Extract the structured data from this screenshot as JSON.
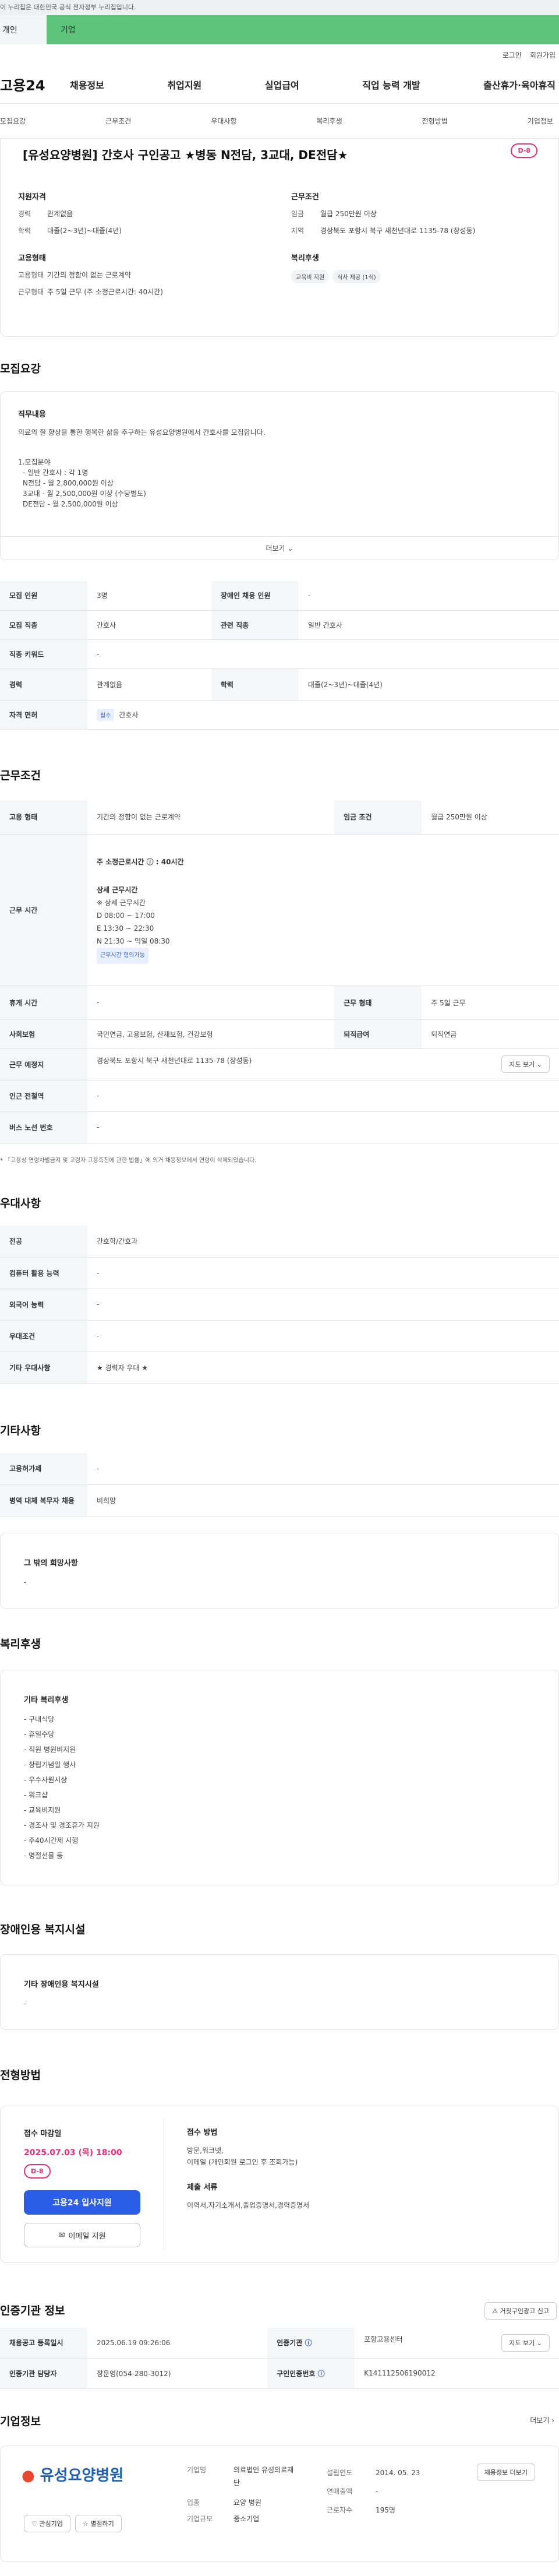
{
  "gov_strip": "이 누리집은 대한민국 공식 전자정부 누리집입니다.",
  "tabs": [
    {
      "label": "개인"
    },
    {
      "label": "기업"
    }
  ],
  "util": {
    "login": "로그인",
    "join": "회원가입"
  },
  "logo": "고용24",
  "gnb": [
    "채용정보",
    "취업지원",
    "실업급여",
    "직업 능력 개발",
    "출산휴가·육아휴직"
  ],
  "subnav": [
    "모집요강",
    "근무조건",
    "우대사항",
    "복리후생",
    "전형방법",
    "기업정보"
  ],
  "summary": {
    "title": "[유성요양병원] 간호사 구인공고 ★병동 N전담, 3교대, DE전담★",
    "dday": "D-8",
    "qual_head": "지원자격",
    "qual": [
      {
        "k": "경력",
        "v": "관계없음"
      },
      {
        "k": "학력",
        "v": "대졸(2~3년)~대졸(4년)"
      }
    ],
    "emp_head": "고용형태",
    "emp": [
      {
        "k": "고용형태",
        "v": "기간의 정함이 없는 근로계약"
      },
      {
        "k": "근무형태",
        "v": "주 5일 근무 (주 소정근로시간: 40시간)"
      }
    ],
    "cond_head": "근무조건",
    "cond": [
      {
        "k": "임금",
        "v": "월급 250만원 이상"
      },
      {
        "k": "지역",
        "v": "경상북도 포항시 북구 새천년대로 1135-78 (장성동)"
      }
    ],
    "welfare_head": "복리후생",
    "welfare_chips": [
      "교육비 지원",
      "식사 제공 (1식)"
    ]
  },
  "recruit": {
    "title": "모집요강",
    "duty_head": "직무내용",
    "duty_text": "의료의 질 향상을 통한 행복한 삶을 추구하는 유성요양병원에서 간호사를 모집합니다.",
    "duty_lines": [
      "1.모집분야",
      "- 일반 간호사 : 각 1명",
      "N전담 - 월 2,800,000원 이상",
      "3교대 - 월 2,500,000원 이상 (수당별도)",
      "DE전담 - 월 2,500,000원 이상"
    ],
    "more": "더보기",
    "rows": [
      {
        "k1": "모집 인원",
        "v1": "3명",
        "k2": "장애인 채용 인원",
        "v2": "-"
      },
      {
        "k1": "모집 직종",
        "v1": "간호사",
        "k2": "관련 직종",
        "v2": "일반 간호사"
      },
      {
        "k1": "직종 키워드",
        "v1": "-"
      },
      {
        "k1": "경력",
        "v1": "관계없음",
        "k2": "학력",
        "v2": "대졸(2~3년)~대졸(4년)"
      },
      {
        "k1": "자격 면허",
        "badge": "필수",
        "v1": "간호사"
      }
    ]
  },
  "work": {
    "title": "근무조건",
    "emp_type_k": "고용 형태",
    "emp_type_v": "기간의 정함이 없는 근로계약",
    "wage_k": "임금 조건",
    "wage_v": "월급 250만원 이상",
    "hours_k": "근무 시간",
    "hours_lines": [
      "주 소정근로시간 ⓘ : 40시간",
      "상세 근무시간",
      "※ 상세 근무시간",
      "D 08:00 ~ 17:00",
      "E 13:30 ~ 22:30",
      "N 21:30 ~ 익일 08:30"
    ],
    "hours_chip": "근무시간 협의가능",
    "rows": [
      {
        "k1": "휴게 시간",
        "v1": "-",
        "k2": "근무 형태",
        "v2": "주 5일 근무"
      },
      {
        "k1": "사회보험",
        "v1": "국민연금, 고용보험, 산재보험, 건강보험",
        "k2": "퇴직급여",
        "v2": "퇴직연금"
      },
      {
        "k1": "근무 예정지",
        "v1": "경상북도 포항시 북구 새천년대로 1135-78 (장성동)",
        "btn": "지도 보기"
      },
      {
        "k1": "인근 전철역",
        "v1": "-"
      },
      {
        "k1": "버스 노선 번호",
        "v1": "-"
      }
    ],
    "note": "* 「고용상 연령차별금지 및 고령자 고용촉진에 관한 법률」에 의거 채용정보에서 연령이 삭제되었습니다."
  },
  "pref": {
    "title": "우대사항",
    "rows": [
      {
        "k": "전공",
        "v": "간호학/간호과"
      },
      {
        "k": "컴퓨터 활용 능력",
        "v": "-"
      },
      {
        "k": "외국어 능력",
        "v": "-"
      },
      {
        "k": "우대조건",
        "v": "-"
      },
      {
        "k": "기타 우대사항",
        "v": "★ 경력자 우대 ★"
      }
    ]
  },
  "etc": {
    "title": "기타사항",
    "rows": [
      {
        "k": "고용허가제",
        "v": "-"
      },
      {
        "k": "병역 대체 복무자 채용",
        "v": "비희망"
      }
    ],
    "box_head": "그 밖의 희망사항",
    "box_val": "-"
  },
  "welfare": {
    "title": "복리후생",
    "box_head": "기타 복리후생",
    "items": [
      "- 구내식당",
      "- 휴일수당",
      "- 직원 병원비지원",
      "- 창립기념일 행사",
      "- 우수사원시상",
      "- 워크샵",
      "- 교육비지원",
      "- 경조사 및 경조휴가 지원",
      "- 주40시간제 시행",
      "- 명절선물 등"
    ]
  },
  "disabled": {
    "title": "장애인용 복지시설",
    "box_head": "기타 장애인용 복지시설",
    "box_val": "-"
  },
  "screening": {
    "title": "전형방법",
    "deadline_head": "접수 마감일",
    "deadline": "2025.07.03 (목) 18:00",
    "dday": "D-8",
    "apply_btn": "고용24 입사지원",
    "email_btn": "이메일 지원",
    "method_head": "접수 방법",
    "method_lines": [
      "방문,워크넷,",
      "이메일 (개인회원 로그인 후 조회가능)"
    ],
    "docs_head": "제출 서류",
    "docs": "이력서,자기소개서,졸업증명서,경력증명서"
  },
  "agency": {
    "title": "인증기관 정보",
    "report_btn": "거짓구인광고 신고",
    "rows": [
      {
        "k1": "채용공고 등록일시",
        "v1": "2025.06.19 09:26:06",
        "k2": "인증기관",
        "v2": "포항고용센터",
        "btn": "지도 보기"
      },
      {
        "k1": "인증기관 담당자",
        "v1": "장운영(054-280-3012)",
        "k2": "구인인증번호",
        "v2": "K141112506190012"
      }
    ]
  },
  "company": {
    "title": "기업정보",
    "more": "더보기",
    "logo_text": "유성요양병원",
    "fav_btn": "관심기업",
    "share_btn": "별점하기",
    "info": [
      {
        "k": "기업명",
        "v": "의료법인 유성의료재단"
      },
      {
        "k": "업종",
        "v": "요양 병원"
      },
      {
        "k": "기업규모",
        "v": "중소기업"
      },
      {
        "k": "설립연도",
        "v": "2014. 05. 23"
      },
      {
        "k": "연매출액",
        "v": "-"
      },
      {
        "k": "근로자수",
        "v": "195명"
      }
    ],
    "list_btn": "채용정보 더보기"
  }
}
